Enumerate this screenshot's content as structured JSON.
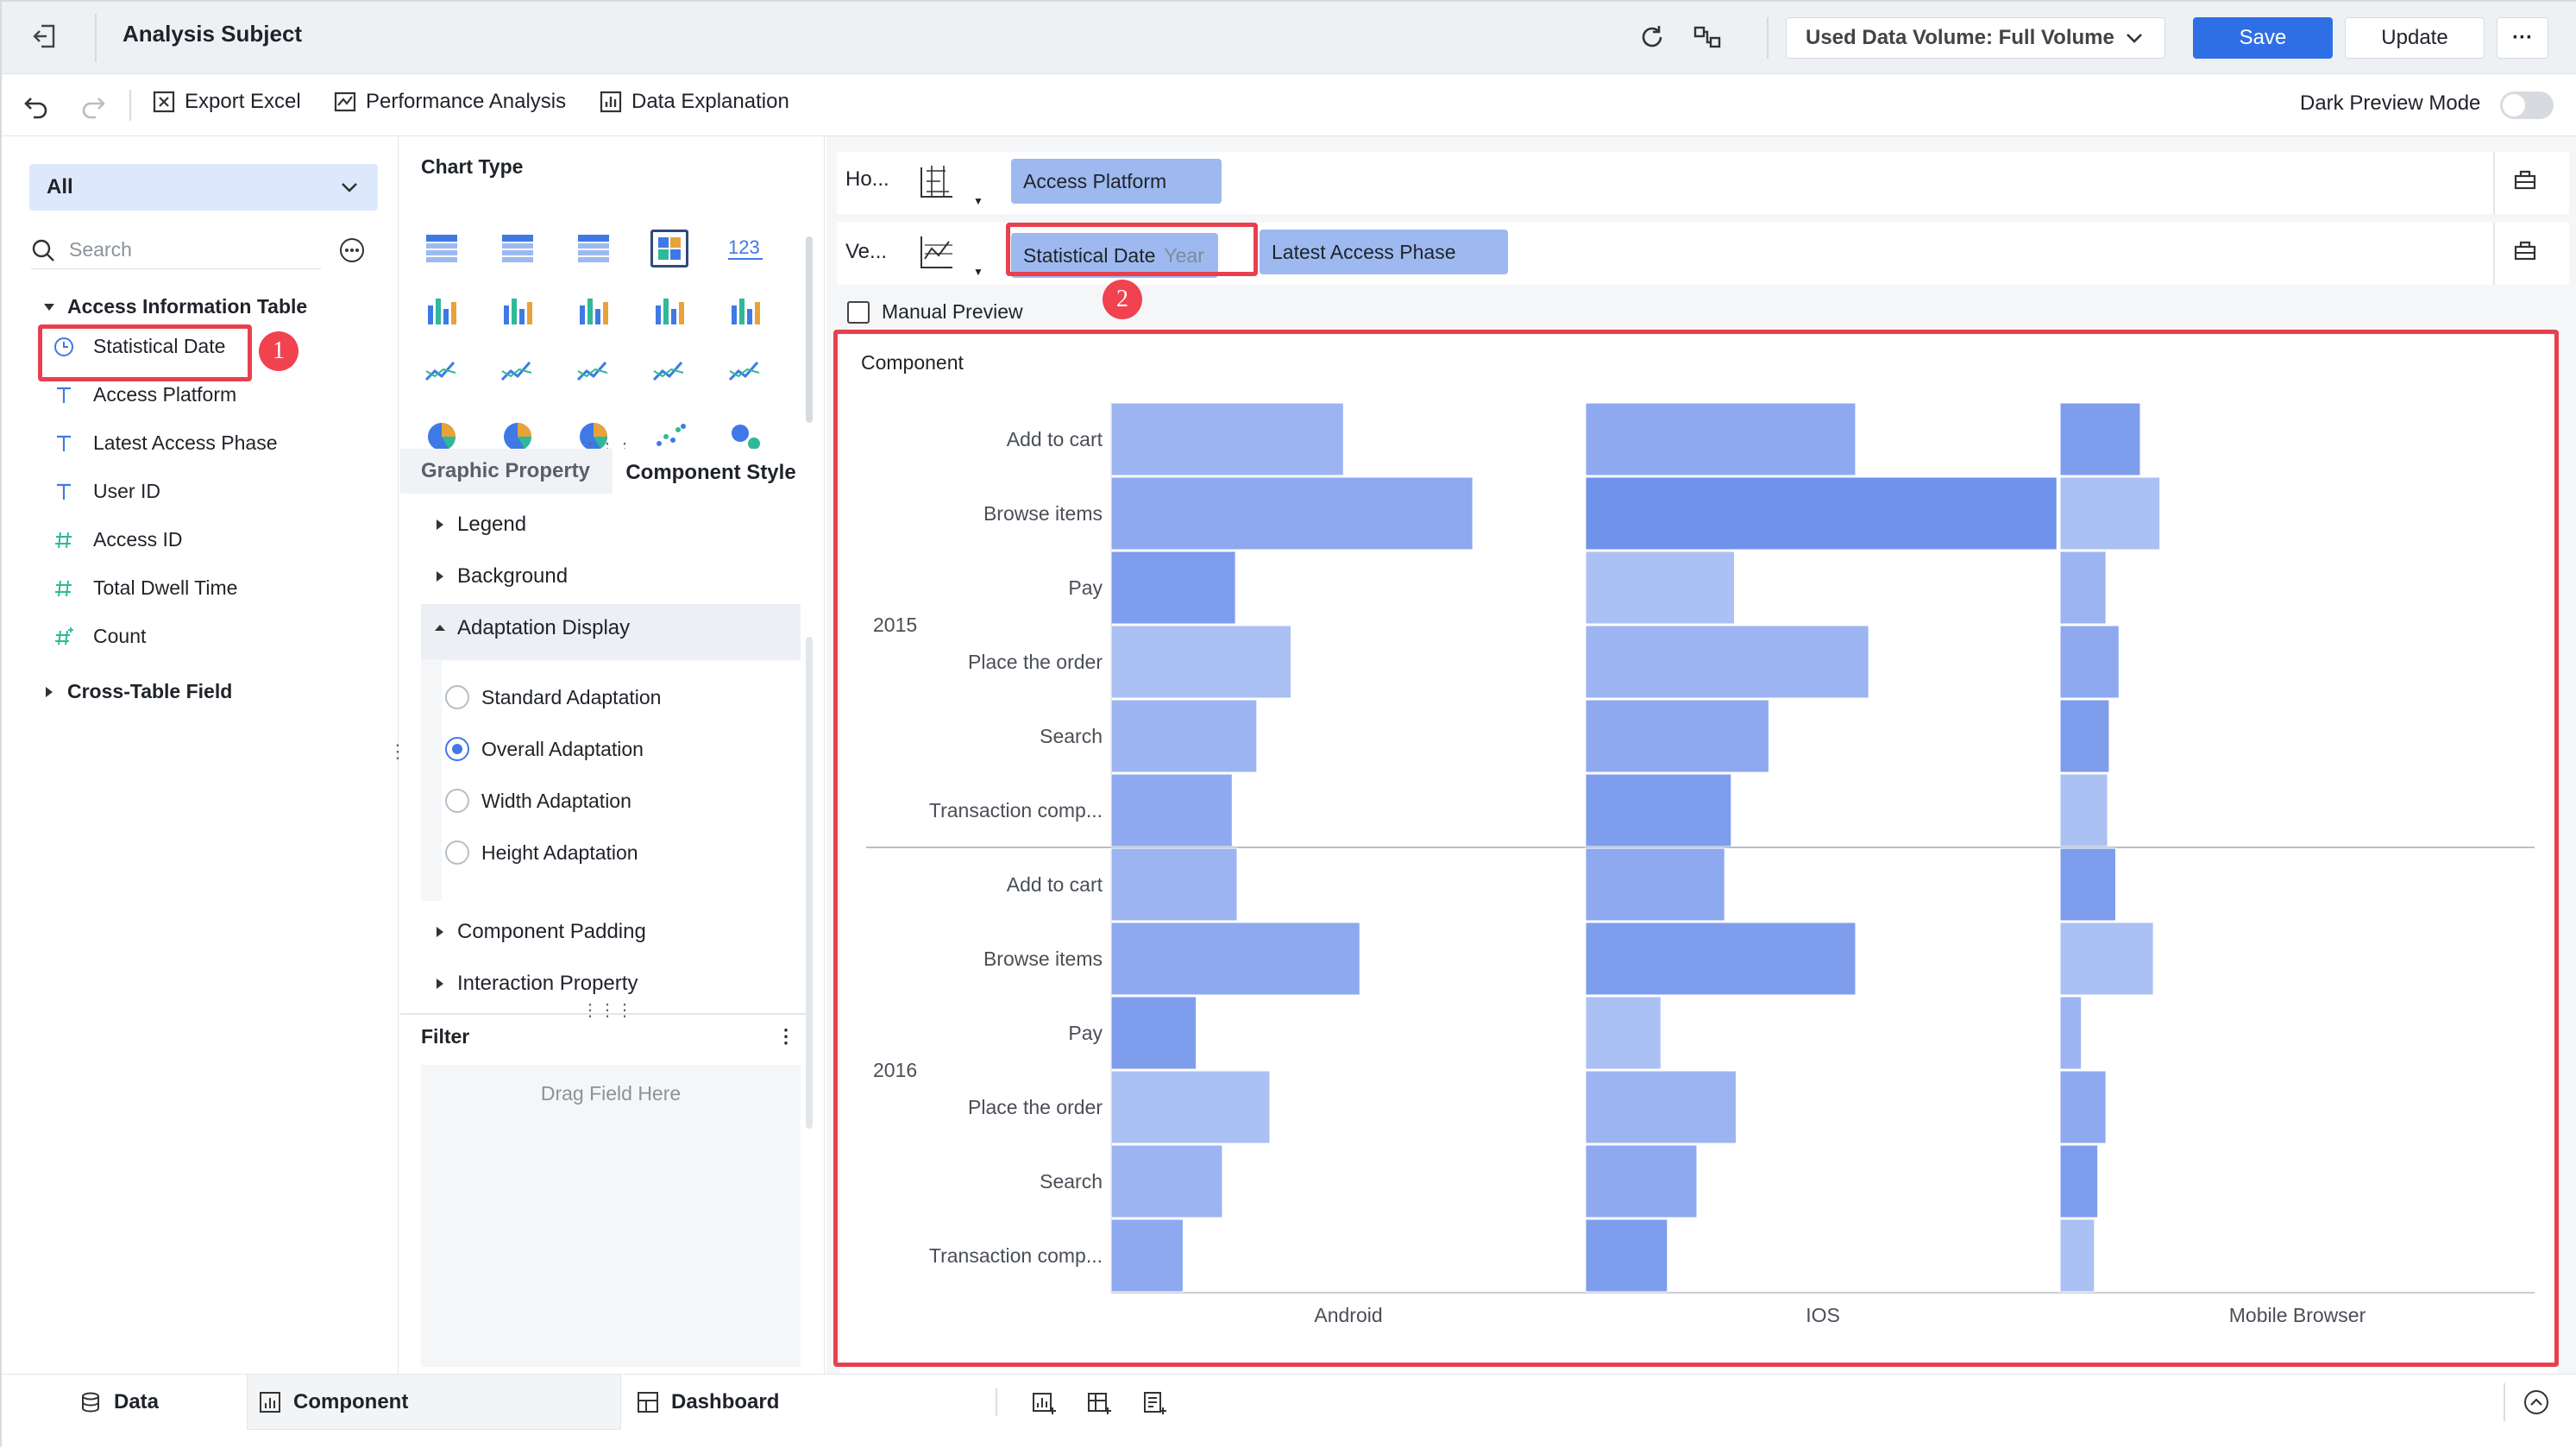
{
  "header": {
    "title": "Analysis Subject",
    "data_volume": "Used Data Volume: Full Volume",
    "save": "Save",
    "update": "Update",
    "more": "···"
  },
  "toolbar": {
    "export_excel": "Export Excel",
    "performance": "Performance Analysis",
    "data_explanation": "Data Explanation",
    "dark_preview": "Dark Preview Mode"
  },
  "left": {
    "filter_value": "All",
    "search_placeholder": "Search",
    "table_name": "Access Information Table",
    "fields": [
      {
        "label": "Statistical Date",
        "icon": "clock-icon"
      },
      {
        "label": "Access Platform",
        "icon": "text-type-icon"
      },
      {
        "label": "Latest Access Phase",
        "icon": "text-type-icon"
      },
      {
        "label": "User ID",
        "icon": "text-type-icon"
      },
      {
        "label": "Access ID",
        "icon": "number-type-icon"
      },
      {
        "label": "Total Dwell Time",
        "icon": "number-type-icon"
      },
      {
        "label": "Count",
        "icon": "calculated-number-icon"
      }
    ],
    "cross_table": "Cross-Table Field"
  },
  "middle": {
    "chart_type_title": "Chart Type",
    "tabs": [
      "Graphic Property",
      "Component Style"
    ],
    "sections": {
      "legend": "Legend",
      "background": "Background",
      "adaptation": "Adaptation Display",
      "padding": "Component Padding",
      "interaction": "Interaction Property"
    },
    "adaptation_options": [
      "Standard Adaptation",
      "Overall Adaptation",
      "Width Adaptation",
      "Height Adaptation"
    ],
    "selected_adaptation": "Overall Adaptation",
    "filter_title": "Filter",
    "drag_hint": "Drag Field Here"
  },
  "shelves": {
    "horizontal_label": "Ho...",
    "vertical_label": "Ve...",
    "horizontal_field": "Access Platform",
    "vertical_field_1": "Statistical Date",
    "vertical_field_1_sub": "Year",
    "vertical_field_2": "Latest Access Phase",
    "manual_preview": "Manual Preview"
  },
  "annotations": {
    "badge1": "1",
    "badge2": "2"
  },
  "bottom": {
    "tabs": [
      "Data",
      "Component",
      "Dashboard"
    ]
  },
  "colors": {
    "accent": "#3f79e6",
    "bar_base": "#8aa8ee",
    "highlight": "#e8404e"
  },
  "chart_data": {
    "type": "bar",
    "title": "Component",
    "orientation": "horizontal",
    "panels": [
      "Android",
      "IOS",
      "Mobile Browser"
    ],
    "groups": [
      {
        "name": "2015",
        "categories": [
          "Add to cart",
          "Browse items",
          "Pay",
          "Place the order",
          "Search",
          "Transaction comp..."
        ],
        "values": {
          "Android": [
            142,
            221,
            76,
            110,
            89,
            74
          ],
          "IOS": [
            165,
            288,
            91,
            173,
            112,
            89
          ],
          "Mobile Browser": [
            49,
            61,
            28,
            36,
            30,
            29
          ]
        }
      },
      {
        "name": "2016",
        "categories": [
          "Add to cart",
          "Browse items",
          "Pay",
          "Place the order",
          "Search",
          "Transaction comp..."
        ],
        "values": {
          "Android": [
            77,
            152,
            52,
            97,
            68,
            44
          ],
          "IOS": [
            85,
            165,
            46,
            92,
            68,
            50
          ],
          "Mobile Browser": [
            34,
            57,
            13,
            28,
            23,
            21
          ]
        }
      }
    ]
  }
}
